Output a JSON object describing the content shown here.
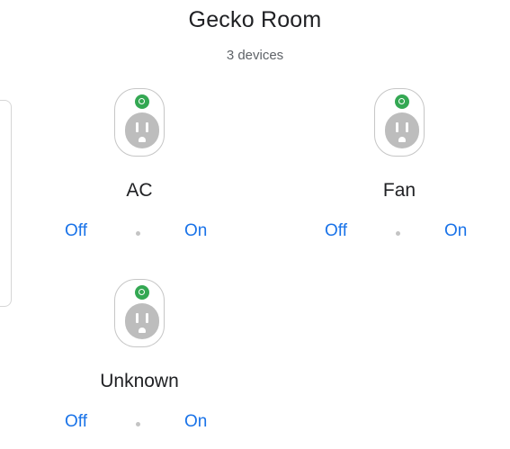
{
  "room": {
    "title": "Gecko Room",
    "subtitle": "3 devices"
  },
  "colors": {
    "accent": "#1a73e8",
    "status_on": "#34a853",
    "outlet_face": "#bdbdbd"
  },
  "devices": [
    {
      "name": "AC",
      "off_label": "Off",
      "on_label": "On",
      "icon": "power-outlet-icon",
      "status": "online"
    },
    {
      "name": "Fan",
      "off_label": "Off",
      "on_label": "On",
      "icon": "power-outlet-icon",
      "status": "online"
    },
    {
      "name": "Unknown",
      "off_label": "Off",
      "on_label": "On",
      "icon": "power-outlet-icon",
      "status": "online"
    }
  ]
}
